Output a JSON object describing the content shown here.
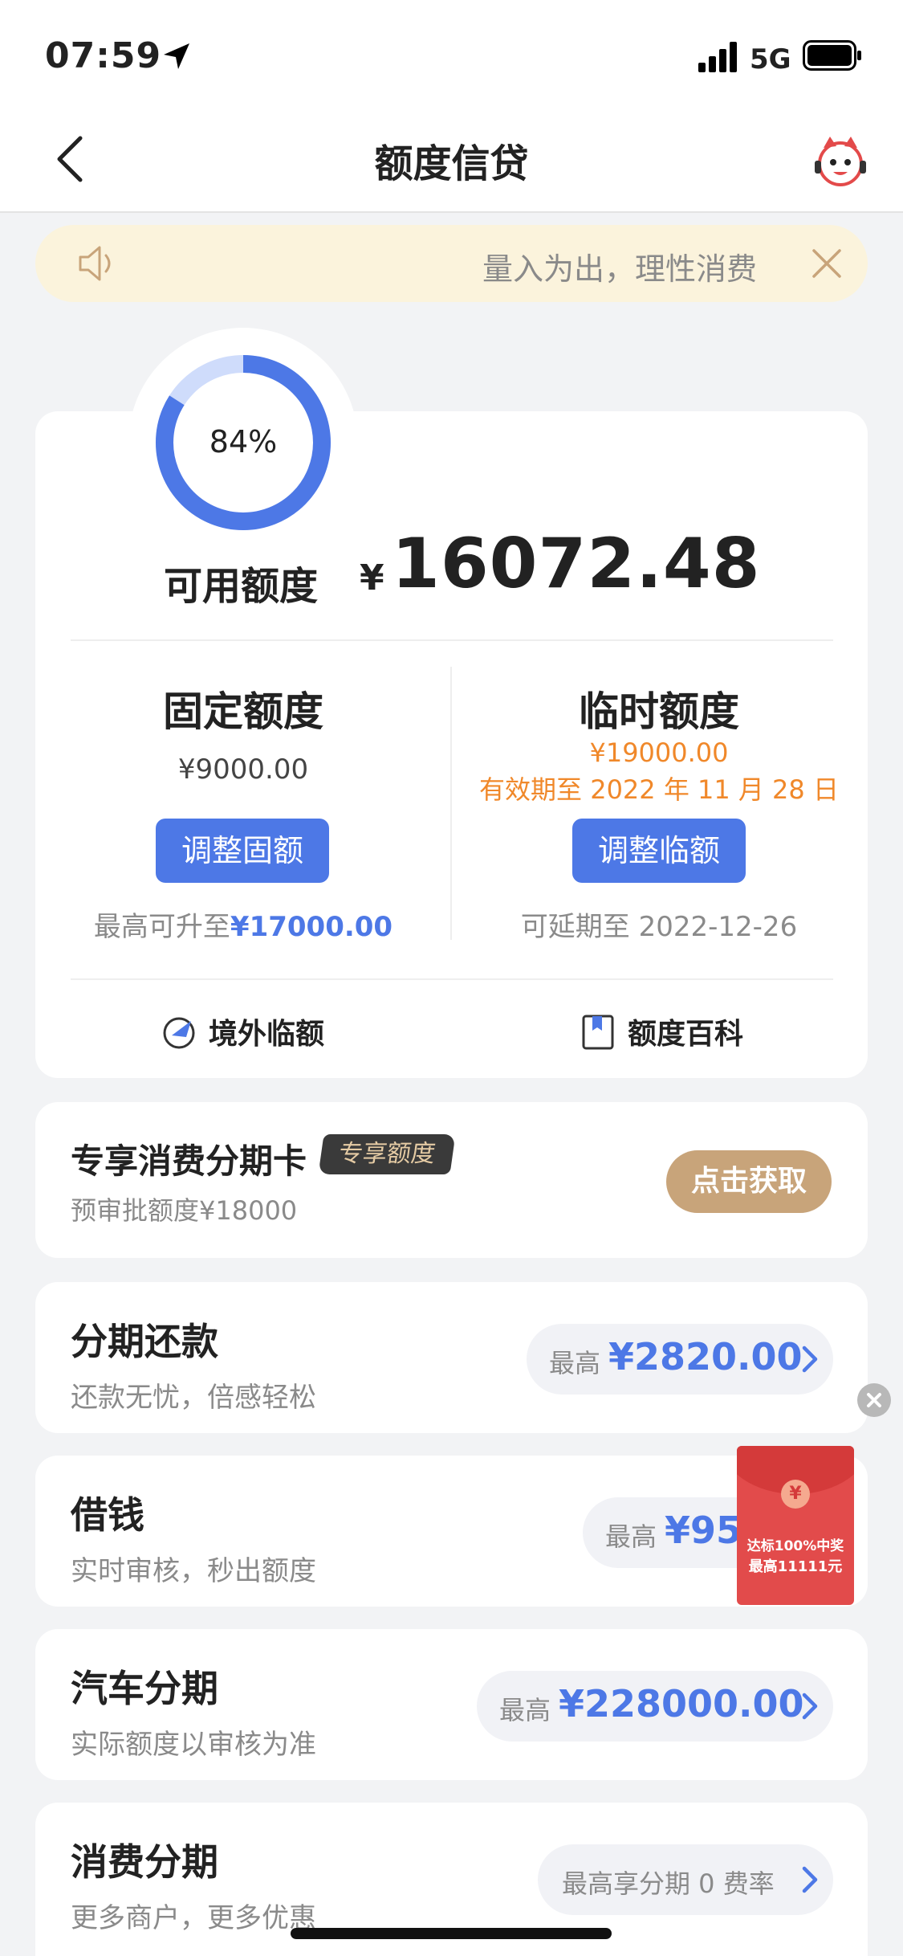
{
  "status_bar": {
    "time": "07:59",
    "network": "5G"
  },
  "nav": {
    "title": "额度信贷"
  },
  "notice": {
    "text": "量入为出，理性消费"
  },
  "credit": {
    "usage_percent": 84,
    "usage_label": "84%",
    "available_label": "可用额度",
    "currency": "¥",
    "available_amount": "16072.48",
    "fixed": {
      "title": "固定额度",
      "amount": "¥9000.00",
      "button": "调整固额",
      "max_prefix": "最高可升至",
      "max_amount": "¥17000.00"
    },
    "temp": {
      "title": "临时额度",
      "amount": "¥19000.00",
      "validity": "有效期至 2022 年 11 月 28 日",
      "button": "调整临额",
      "extend_text": "可延期至 2022-12-26"
    },
    "links": {
      "overseas": "境外临额",
      "encyclopedia": "额度百科"
    }
  },
  "installment_card": {
    "title": "专享消费分期卡",
    "badge": "专享额度",
    "sub": "预审批额度¥18000",
    "button": "点击获取"
  },
  "services": [
    {
      "title": "分期还款",
      "sub": "还款无忧，倍感轻松",
      "prefix": "最高",
      "value": "¥2820.00"
    },
    {
      "title": "借钱",
      "sub": "实时审核，秒出额度",
      "prefix": "最高",
      "value": "¥95"
    },
    {
      "title": "汽车分期",
      "sub": "实际额度以审核为准",
      "prefix": "最高",
      "value": "¥228000.00"
    },
    {
      "title": "消费分期",
      "sub": "更多商户，更多优惠",
      "prefix": "",
      "value": "最高享分期 0 费率"
    }
  ],
  "red_packet": {
    "symbol": "¥",
    "line1": "达标100%中奖",
    "line2": "最高11111元"
  },
  "colors": {
    "accent": "#4d78e6",
    "orange": "#f0882a",
    "gold": "#c8a47a",
    "notice_bg": "#fbf3dc"
  }
}
